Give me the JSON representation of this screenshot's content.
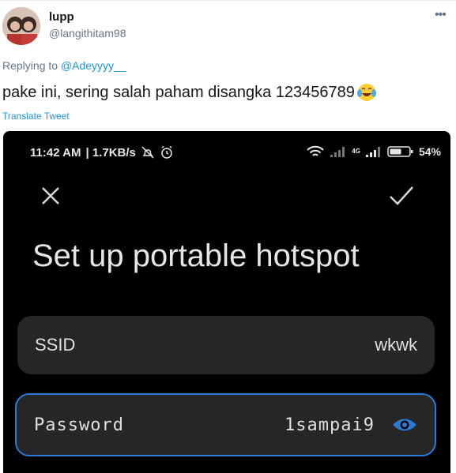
{
  "tweet": {
    "display_name": "lupp",
    "handle": "@langithitam98",
    "more_icon": "more-horizontal-icon",
    "replying_to_label": "Replying to",
    "replying_to_handle": "@Adeyyyy__",
    "text": "pake ini, sering salah paham disangka 123456789",
    "emoji": "face-with-tears-of-joy-icon",
    "translate_label": "Translate Tweet"
  },
  "phone": {
    "status_bar": {
      "time": "11:42 AM",
      "speed": "| 1.7KB/s",
      "network_label": "4G",
      "battery": "54%",
      "icons": [
        "alarm-off-icon",
        "alarm-icon",
        "wifi-icon",
        "signal-icon",
        "battery-icon"
      ]
    },
    "header": {
      "close_icon": "close-icon",
      "confirm_icon": "check-icon"
    },
    "title": "Set up portable hotspot",
    "fields": {
      "ssid": {
        "label": "SSID",
        "value": "wkwk"
      },
      "password": {
        "label": "Password",
        "value": "1sampai9",
        "toggle_icon": "eye-icon"
      }
    },
    "colors": {
      "background": "#000000",
      "field_bg": "#262626",
      "accent": "#2a7ad8",
      "link": "#1b95e0"
    }
  }
}
